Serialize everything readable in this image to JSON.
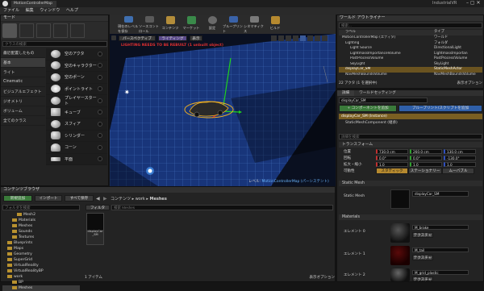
{
  "app": {
    "title": "MotionControllerMap",
    "project": "IndustrialVR"
  },
  "menu": [
    "ファイル",
    "編集",
    "ウィンドウ",
    "ヘルプ"
  ],
  "modes": {
    "tab": "モード",
    "search_placeholder": "クラスの検索",
    "categories": [
      "最近配置したもの",
      "基本",
      "ライト",
      "Cinematic",
      "ビジュアルエフェクト",
      "ジオメトリ",
      "ボリューム",
      "全てのクラス"
    ],
    "items": [
      "空のアクタ",
      "空のキャラクター",
      "空のポーン",
      "ポイントライト",
      "プレイヤースタート",
      "キューブ",
      "スフィア",
      "シリンダー",
      "コーン",
      "平面"
    ]
  },
  "toolbar": [
    {
      "label": "現在のレベルを保存",
      "color": "#3f6fb0"
    },
    {
      "label": "ソースコントロール",
      "color": "#5a5a5a"
    },
    {
      "label": "コンテンツ",
      "color": "#b38d3a"
    },
    {
      "label": "マーケット",
      "color": "#3a8a4a"
    },
    {
      "label": "設定",
      "color": "#6a6a6a"
    },
    {
      "label": "ブループリント",
      "color": "#3a62a8"
    },
    {
      "label": "シネマティクス",
      "color": "#7a7a7a"
    },
    {
      "label": "ビルド",
      "color": "#b5892f"
    }
  ],
  "viewport": {
    "perspective": "パースペクティブ",
    "lighting": "ライティング",
    "show": "表示",
    "warning": "LIGHTING NEEDS TO BE REBUILT (1 unbuilt object)",
    "level_label": "レベル:",
    "level_name": "MotionControllerMap (パーシステント)"
  },
  "outliner": {
    "tab": "ワールド アウトライナー",
    "search_placeholder": "検索...",
    "col_label": "ラベル",
    "col_type": "タイプ",
    "rows": [
      {
        "label": "MotionControllerMap (エディタ)",
        "type": "ワールド",
        "sel": false
      },
      {
        "label": "Lighting",
        "type": "フォルダ",
        "sel": false
      },
      {
        "label": "Light Source",
        "type": "DirectionalLight",
        "sel": false
      },
      {
        "label": "LightmassImportanceVolume",
        "type": "LightmassImportan",
        "sel": false
      },
      {
        "label": "PostProcessVolume",
        "type": "PostProcessVolume",
        "sel": false
      },
      {
        "label": "SkyLight",
        "type": "SkyLight",
        "sel": false
      },
      {
        "label": "displayCar_SM",
        "type": "StaticMeshActor",
        "sel": true
      },
      {
        "label": "NavMeshBoundsVolume",
        "type": "NavMeshBoundsVolume",
        "sel": false
      }
    ],
    "count": "22 アクタ (1 を選択中)",
    "view_options": "表示オプション"
  },
  "details": {
    "tab1": "詳細",
    "tab2": "ワールドセッティング",
    "name": "displayCar_SM",
    "add_component": "+ コンポーネントを追加",
    "blueprint_btn": "ブループリント/スクリプトを追加",
    "instance": "displayCar_SM (Instance)",
    "component": "StaticMeshComponent (継承)",
    "search_placeholder": "詳細を検索",
    "transform": "トランスフォーム",
    "location_label": "位置",
    "rotation_label": "回転",
    "scale_label": "拡大・縮小",
    "location": [
      "730.0 cm",
      "260.0 cm",
      "130.0 cm"
    ],
    "rotation": [
      "0.0°",
      "0.0°",
      "-130.0°"
    ],
    "scale": [
      "1.0",
      "1.0",
      "1.0"
    ],
    "mobility_label": "可動性",
    "mobility": [
      "スタティック",
      "ステーショナリー",
      "ムーバブル"
    ],
    "static_mesh_section": "Static Mesh",
    "static_mesh_label": "Static Mesh",
    "static_mesh_value": "displayCar_SM",
    "materials_section": "Materials",
    "element0": "エレメント 0",
    "element1": "エレメント 1",
    "element2": "エレメント 2",
    "mat0": "M_brake",
    "mat1": "M_tail",
    "mat2": "M_grid_plastic",
    "texture": "テクスチャ"
  },
  "content_browser": {
    "tab": "コンテンツブラウザ",
    "add_new": "新規追加",
    "import": "インポート",
    "save_all": "すべて保存",
    "path": [
      "コンテンツ",
      "work",
      "Meshes"
    ],
    "filter": "フィルタ",
    "search_placeholder": "検索 Meshes",
    "folder_search": "フォルダを検索",
    "folders": [
      {
        "name": "Mesh2",
        "indent": 3
      },
      {
        "name": "Materials",
        "indent": 2
      },
      {
        "name": "Meshes",
        "indent": 2
      },
      {
        "name": "Sounds",
        "indent": 2
      },
      {
        "name": "Textures",
        "indent": 2
      },
      {
        "name": "Blueprints",
        "indent": 1
      },
      {
        "name": "Maps",
        "indent": 1
      },
      {
        "name": "Geometry",
        "indent": 1
      },
      {
        "name": "SuperGrid",
        "indent": 1
      },
      {
        "name": "VirtualReality",
        "indent": 1
      },
      {
        "name": "VirtualRealityBP",
        "indent": 1
      },
      {
        "name": "work",
        "indent": 1
      },
      {
        "name": "BP",
        "indent": 2
      },
      {
        "name": "Meshes",
        "indent": 2
      }
    ],
    "asset_name": "displayCar_SM",
    "item_count": "1 アイテム",
    "view_options": "表示オプション"
  }
}
